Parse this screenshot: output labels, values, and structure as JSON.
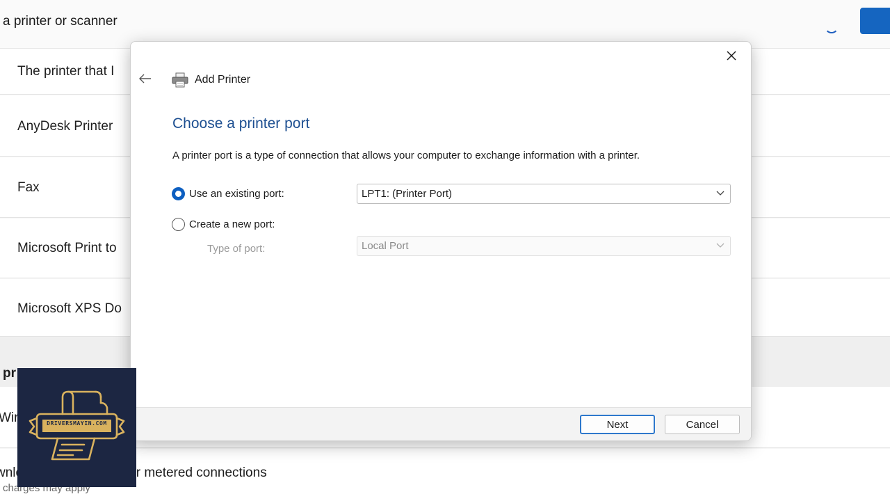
{
  "background": {
    "header_title": "a printer or scanner",
    "printers": [
      "The printer that I",
      "AnyDesk Printer",
      "Fax",
      "Microsoft Print to",
      "Microsoft XPS Do"
    ],
    "section_title": "pr",
    "row_partial": "Wir",
    "metered_text": "wnlo     evice software over metered connections",
    "metered_sub": "charges may apply"
  },
  "dialog": {
    "title": "Add Printer",
    "heading": "Choose a printer port",
    "description": "A printer port is a type of connection that allows your computer to exchange information with a printer.",
    "existing_port_label": "Use an existing port:",
    "existing_port_value": "LPT1: (Printer Port)",
    "new_port_label": "Create a new port:",
    "type_of_port_label": "Type of port:",
    "type_of_port_value": "Local Port",
    "selected_option": "existing",
    "next_label": "Next",
    "cancel_label": "Cancel"
  },
  "logo": {
    "text": "DRIVERSMAYIN.COM",
    "icon": "printer-logo-icon"
  },
  "colors": {
    "accent": "#0d5fc1",
    "heading": "#1d4f91",
    "logo_bg": "#1c2642",
    "logo_gold": "#d9b25e"
  }
}
